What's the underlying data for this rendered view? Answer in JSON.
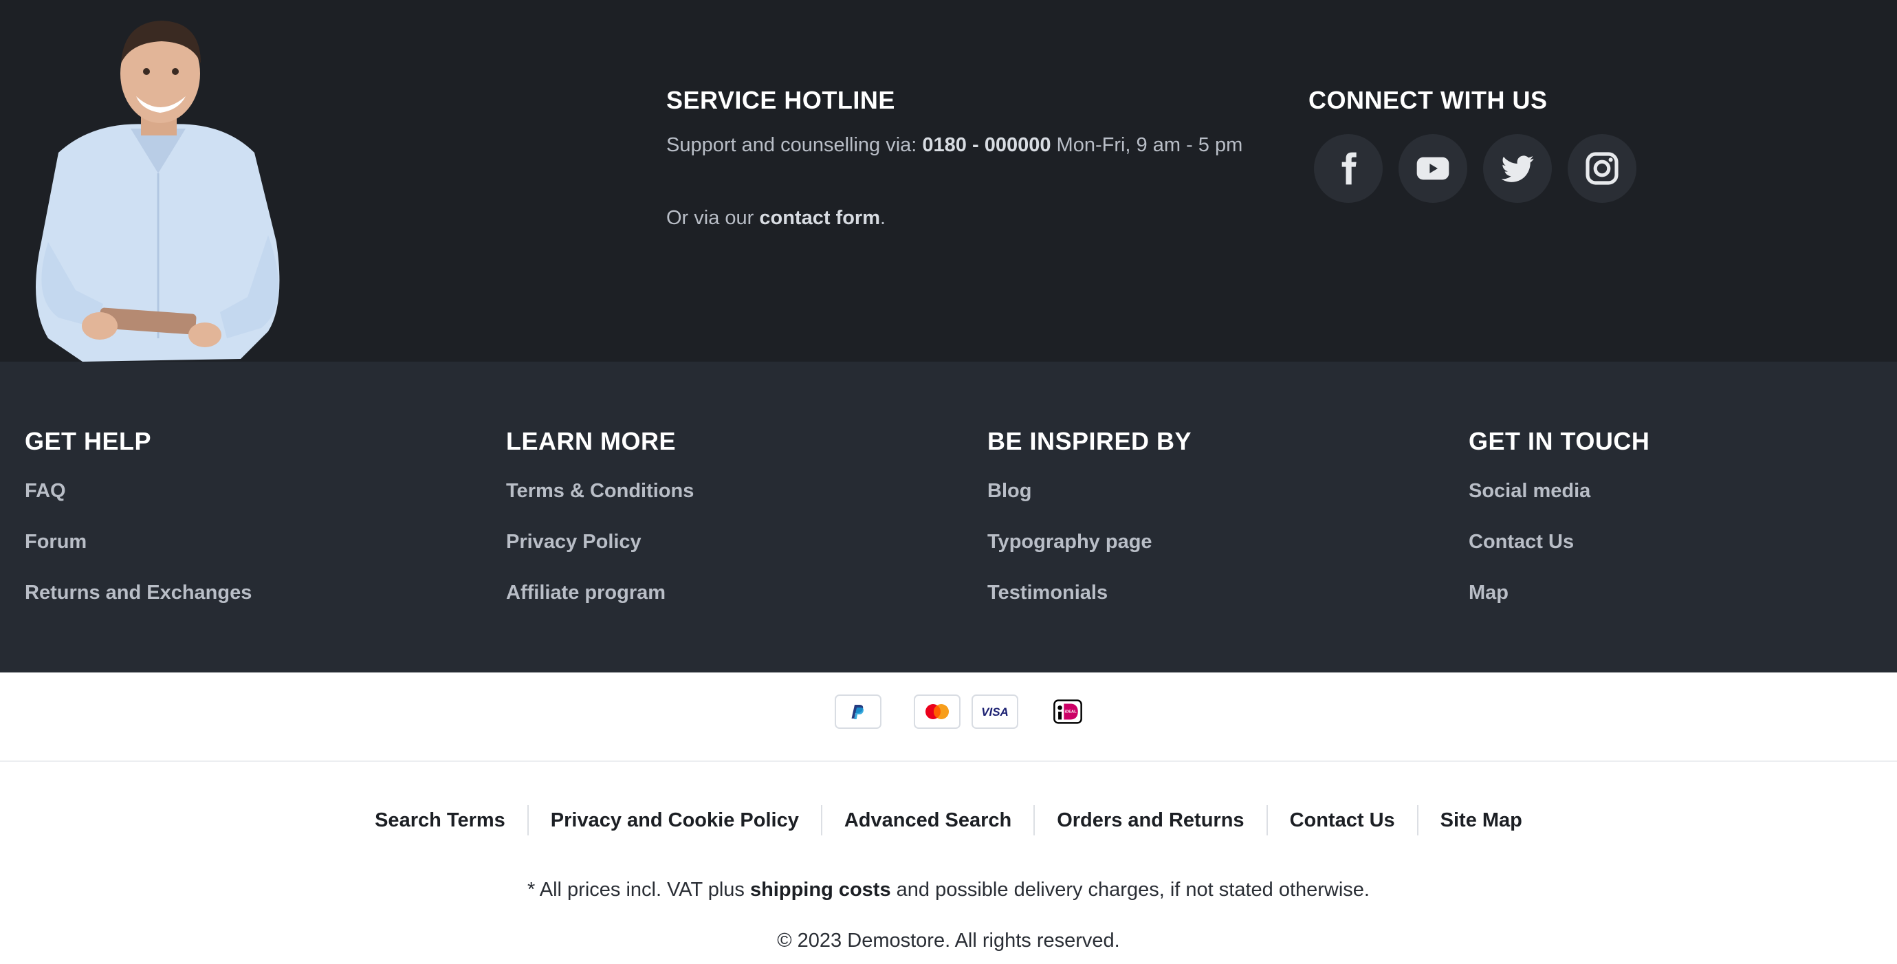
{
  "hotline": {
    "title": "SERVICE HOTLINE",
    "support_prefix": "Support and counselling via: ",
    "phone": "0180 - 000000",
    "hours": " Mon-Fri, 9 am - 5 pm",
    "contact_prefix": "Or via our ",
    "contact_link": "contact form",
    "contact_suffix": "."
  },
  "connect": {
    "title": "CONNECT WITH US",
    "icons": [
      "facebook-icon",
      "youtube-icon",
      "twitter-icon",
      "instagram-icon"
    ]
  },
  "columns": [
    {
      "title": "GET HELP",
      "links": [
        "FAQ",
        "Forum",
        "Returns and Exchanges"
      ]
    },
    {
      "title": "LEARN MORE",
      "links": [
        "Terms & Conditions",
        "Privacy Policy",
        "Affiliate program"
      ]
    },
    {
      "title": "BE INSPIRED BY",
      "links": [
        "Blog",
        "Typography page",
        "Testimonials"
      ]
    },
    {
      "title": "GET IN TOUCH",
      "links": [
        "Social media",
        "Contact Us",
        "Map"
      ]
    }
  ],
  "payments": [
    "paypal-icon",
    "mastercard-icon",
    "visa-icon",
    "ideal-icon"
  ],
  "payment_labels": {
    "visa": "VISA",
    "ideal": "iDEAL"
  },
  "bottom_nav": [
    "Search Terms",
    "Privacy and Cookie Policy",
    "Advanced Search",
    "Orders and Returns",
    "Contact Us",
    "Site Map"
  ],
  "legal": {
    "vat_prefix": "* All prices incl. VAT plus ",
    "vat_link": "shipping costs",
    "vat_suffix": " and possible delivery charges, if not stated otherwise.",
    "copyright": "© 2023 Demostore. All rights reserved."
  },
  "colors": {
    "top_band": "#1d2025",
    "links_band": "#262b33",
    "link_text": "#b9bec7",
    "social_button": "#2a2e35"
  }
}
